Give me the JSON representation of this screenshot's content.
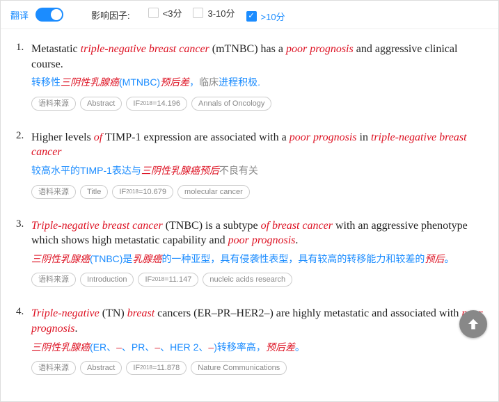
{
  "topbar": {
    "translate_label": "翻译",
    "factor_label": "影响因子:",
    "options": [
      {
        "label": "<3分",
        "checked": false
      },
      {
        "label": "3-10分",
        "checked": false
      },
      {
        "label": ">10分",
        "checked": true
      }
    ]
  },
  "tag_source_label": "语料来源",
  "if_prefix": "IF",
  "if_year": "2018",
  "items": [
    {
      "num": "1.",
      "sentence_parts": [
        {
          "t": "Metastatic ",
          "kw": false
        },
        {
          "t": "triple-negative breast cancer",
          "kw": true
        },
        {
          "t": " (mTNBC) has a ",
          "kw": false
        },
        {
          "t": "poor prognosis",
          "kw": true
        },
        {
          "t": " and aggressive clinical course.",
          "kw": false
        }
      ],
      "trans_parts": [
        {
          "t": "转移性",
          "cls": ""
        },
        {
          "t": "三阴性乳腺癌",
          "cls": "kw"
        },
        {
          "t": "(MTNBC)",
          "cls": ""
        },
        {
          "t": "预后差",
          "cls": "kw"
        },
        {
          "t": "，",
          "cls": ""
        },
        {
          "t": "临床",
          "cls": "gray"
        },
        {
          "t": "进程积极.",
          "cls": ""
        }
      ],
      "section": "Abstract",
      "if_value": "=14.196",
      "journal": "Annals of Oncology"
    },
    {
      "num": "2.",
      "sentence_parts": [
        {
          "t": "Higher levels ",
          "kw": false
        },
        {
          "t": "of",
          "kw": true
        },
        {
          "t": " TIMP-1 expression are associated with a ",
          "kw": false
        },
        {
          "t": "poor prognosis",
          "kw": true
        },
        {
          "t": " in ",
          "kw": false
        },
        {
          "t": "triple-negative breast cancer",
          "kw": true
        }
      ],
      "trans_parts": [
        {
          "t": "较高水平的TIMP-1表达与",
          "cls": ""
        },
        {
          "t": "三阴性乳腺癌预后",
          "cls": "kw"
        },
        {
          "t": "不良有关",
          "cls": "gray"
        }
      ],
      "section": "Title",
      "if_value": "=10.679",
      "journal": "molecular cancer"
    },
    {
      "num": "3.",
      "sentence_parts": [
        {
          "t": "Triple-negative breast cancer",
          "kw": true
        },
        {
          "t": " (TNBC) is a subtype ",
          "kw": false
        },
        {
          "t": "of breast cancer",
          "kw": true
        },
        {
          "t": " with an aggressive phenotype which shows high metastatic capability and ",
          "kw": false
        },
        {
          "t": "poor prognosis",
          "kw": true
        },
        {
          "t": ".",
          "kw": false
        }
      ],
      "trans_parts": [
        {
          "t": "三阴性乳腺癌",
          "cls": "kw"
        },
        {
          "t": "(TNBC)是",
          "cls": ""
        },
        {
          "t": "乳腺癌",
          "cls": "kw"
        },
        {
          "t": "的一种亚型，具有侵袭性表型，具有较高的转移能力和较差的",
          "cls": ""
        },
        {
          "t": "预后",
          "cls": "kw"
        },
        {
          "t": "。",
          "cls": ""
        }
      ],
      "section": "Introduction",
      "if_value": "=11.147",
      "journal": "nucleic acids research"
    },
    {
      "num": "4.",
      "sentence_parts": [
        {
          "t": "Triple-negative",
          "kw": true
        },
        {
          "t": " (TN) ",
          "kw": false
        },
        {
          "t": "breast",
          "kw": true
        },
        {
          "t": " cancers (ER–PR–HER2–) are highly metastatic and associated with ",
          "kw": false
        },
        {
          "t": "poor prognosis",
          "kw": true
        },
        {
          "t": ".",
          "kw": false
        }
      ],
      "trans_parts": [
        {
          "t": "三阴性乳腺癌",
          "cls": "kw"
        },
        {
          "t": "(ER、",
          "cls": ""
        },
        {
          "t": "–",
          "cls": "kw"
        },
        {
          "t": "、PR、",
          "cls": ""
        },
        {
          "t": "–",
          "cls": "kw"
        },
        {
          "t": "、HER 2、",
          "cls": ""
        },
        {
          "t": "–",
          "cls": "kw"
        },
        {
          "t": ")转移率高，",
          "cls": ""
        },
        {
          "t": "预后差",
          "cls": "kw"
        },
        {
          "t": "。",
          "cls": ""
        }
      ],
      "section": "Abstract",
      "if_value": "=11.878",
      "journal": "Nature Communications"
    }
  ]
}
